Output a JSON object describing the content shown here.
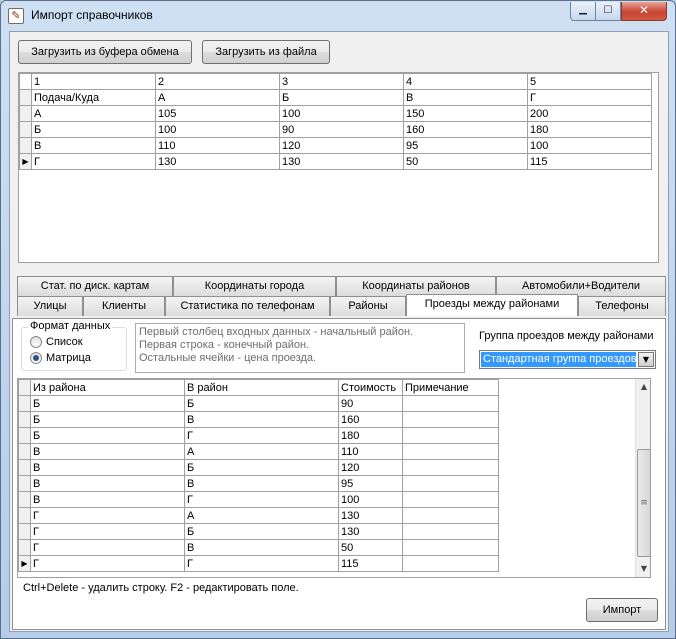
{
  "window": {
    "title": "Импорт справочников",
    "icon": "document-icon",
    "controls": {
      "minimize": "▁",
      "maximize": "☐",
      "close": "✕"
    }
  },
  "toolbar": {
    "load_clipboard": "Загрузить из буфера обмена",
    "load_file": "Загрузить из файла"
  },
  "top_grid": {
    "header": [
      "1",
      "2",
      "3",
      "4",
      "5"
    ],
    "rows": [
      [
        "Подача/Куда",
        "А",
        "Б",
        "В",
        "Г"
      ],
      [
        "А",
        "105",
        "100",
        "150",
        "200"
      ],
      [
        "Б",
        "100",
        "90",
        "160",
        "180"
      ],
      [
        "В",
        "110",
        "120",
        "95",
        "100"
      ],
      [
        "Г",
        "130",
        "130",
        "50",
        "115"
      ]
    ],
    "current_row_marker": "▶"
  },
  "tabs": {
    "row_top": [
      "Стат. по диск. картам",
      "Координаты города",
      "Координаты районов",
      "Автомобили+Водители"
    ],
    "row_bottom": [
      "Улицы",
      "Клиенты",
      "Статистика по телефонам",
      "Районы",
      "Проезды между районами",
      "Телефоны"
    ],
    "active": "Проезды между районами"
  },
  "format": {
    "title": "Формат данных",
    "list_label": "Список",
    "matrix_label": "Матрица",
    "selected": "matrix"
  },
  "info": {
    "line1": "Первый столбец входных данных - начальный район.",
    "line2": "Первая строка - конечный район.",
    "line3": "Остальные ячейки - цена проезда."
  },
  "group": {
    "label": "Группа проездов между районами",
    "value": "Стандартная группа проездов"
  },
  "bottom_grid": {
    "columns": [
      "Из района",
      "В район",
      "Стоимость",
      "Примечание"
    ],
    "rows": [
      [
        "Б",
        "Б",
        "90",
        ""
      ],
      [
        "Б",
        "В",
        "160",
        ""
      ],
      [
        "Б",
        "Г",
        "180",
        ""
      ],
      [
        "В",
        "А",
        "110",
        ""
      ],
      [
        "В",
        "Б",
        "120",
        ""
      ],
      [
        "В",
        "В",
        "95",
        ""
      ],
      [
        "В",
        "Г",
        "100",
        ""
      ],
      [
        "Г",
        "А",
        "130",
        ""
      ],
      [
        "Г",
        "Б",
        "130",
        ""
      ],
      [
        "Г",
        "В",
        "50",
        ""
      ],
      [
        "Г",
        "Г",
        "115",
        ""
      ]
    ],
    "current_row_marker": "▶"
  },
  "hint": "Ctrl+Delete - удалить строку. F2 - редактировать поле.",
  "import_label": "Импорт"
}
